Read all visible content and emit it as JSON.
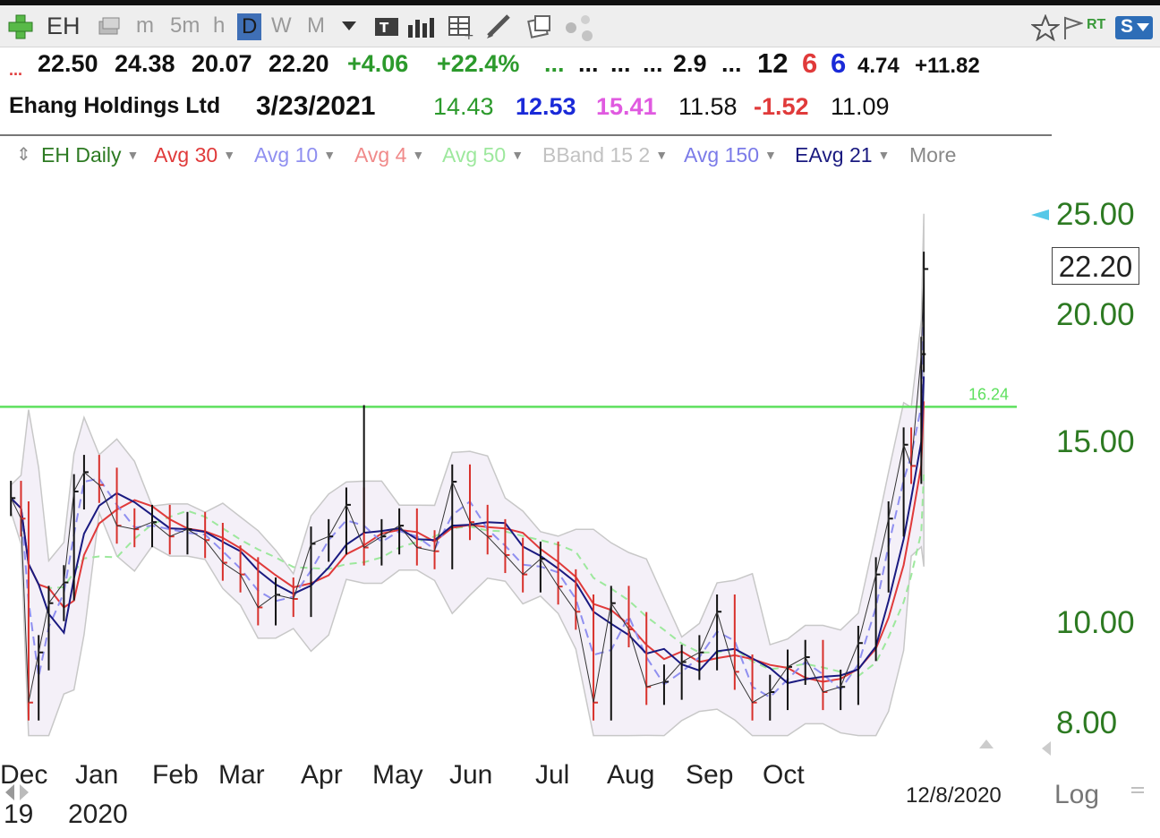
{
  "toolbar": {
    "symbol": "EH",
    "intervals": [
      "m",
      "5m",
      "h",
      "D",
      "W",
      "M"
    ],
    "selected_interval": "D",
    "rt_label": "RT",
    "s_label": "S"
  },
  "quote": {
    "open": "22.50",
    "high": "24.38",
    "low": "20.07",
    "close": "22.20",
    "change": "+4.06",
    "change_pct": "+22.4%",
    "dots1": "...",
    "dots2": "...",
    "dots3": "...",
    "dots4": "...",
    "v1": "2.9",
    "dots5": "...",
    "v2": "12",
    "v3": "6",
    "v4": "6",
    "v5": "4.74",
    "v6": "+11.82",
    "name": "Ehang Holdings Ltd",
    "date": "3/23/2021",
    "w1": "14.43",
    "w2": "12.53",
    "w3": "15.41",
    "w4": "11.58",
    "w5": "-1.52",
    "w6": "11.09"
  },
  "studies": [
    {
      "label": "EH Daily",
      "color": "#2d7a22"
    },
    {
      "label": "Avg 30",
      "color": "#e03a3a"
    },
    {
      "label": "Avg 10",
      "color": "#8f8ff0"
    },
    {
      "label": "Avg 4",
      "color": "#f08a8a"
    },
    {
      "label": "Avg 50",
      "color": "#9de89d"
    },
    {
      "label": "BBand 15 2",
      "color": "#c2c2c2"
    },
    {
      "label": "Avg 150",
      "color": "#7b7be8"
    },
    {
      "label": "EAvg 21",
      "color": "#1a1a80"
    },
    {
      "label": "More",
      "color": "#888888"
    }
  ],
  "chart_data": {
    "type": "line",
    "scale": "log",
    "ylim": [
      7.6,
      27
    ],
    "yticks": [
      "25.00",
      "20.00",
      "15.00",
      "10.00",
      "8.00"
    ],
    "last_price": "22.20",
    "horizontal_line": {
      "value": 16.24,
      "label": "16.24",
      "color": "#5ee05e"
    },
    "xticks": [
      "Dec",
      "Jan",
      "Feb",
      "Mar",
      "Apr",
      "May",
      "Jun",
      "Jul",
      "Aug",
      "Sep",
      "Oct"
    ],
    "year_labels": [
      "19",
      "2020"
    ],
    "cursor_date": "12/8/2020",
    "scale_label": "Log",
    "close_series": [
      [
        "2019-12-12",
        13.2
      ],
      [
        "2019-12-16",
        12.6
      ],
      [
        "2019-12-19",
        8.3
      ],
      [
        "2019-12-23",
        9.3
      ],
      [
        "2019-12-27",
        10.4
      ],
      [
        "2020-01-02",
        10.9
      ],
      [
        "2020-01-06",
        13.4
      ],
      [
        "2020-01-10",
        14.0
      ],
      [
        "2020-01-16",
        13.6
      ],
      [
        "2020-01-23",
        12.4
      ],
      [
        "2020-01-30",
        12.3
      ],
      [
        "2020-02-06",
        12.5
      ],
      [
        "2020-02-13",
        12.1
      ],
      [
        "2020-02-20",
        12.3
      ],
      [
        "2020-02-27",
        12.0
      ],
      [
        "2020-03-05",
        11.4
      ],
      [
        "2020-03-12",
        11.1
      ],
      [
        "2020-03-19",
        10.3
      ],
      [
        "2020-03-26",
        10.6
      ],
      [
        "2020-04-02",
        10.5
      ],
      [
        "2020-04-09",
        11.9
      ],
      [
        "2020-04-16",
        12.1
      ],
      [
        "2020-04-23",
        13.0
      ],
      [
        "2020-04-30",
        11.8
      ],
      [
        "2020-05-07",
        12.1
      ],
      [
        "2020-05-14",
        12.4
      ],
      [
        "2020-05-21",
        11.8
      ],
      [
        "2020-05-28",
        11.7
      ],
      [
        "2020-06-04",
        13.7
      ],
      [
        "2020-06-11",
        12.5
      ],
      [
        "2020-06-18",
        12.1
      ],
      [
        "2020-06-25",
        11.6
      ],
      [
        "2020-07-02",
        11.1
      ],
      [
        "2020-07-09",
        11.5
      ],
      [
        "2020-07-16",
        10.8
      ],
      [
        "2020-07-23",
        10.2
      ],
      [
        "2020-07-30",
        8.3
      ],
      [
        "2020-08-06",
        10.4
      ],
      [
        "2020-08-13",
        9.8
      ],
      [
        "2020-08-20",
        8.6
      ],
      [
        "2020-08-27",
        8.7
      ],
      [
        "2020-09-03",
        9.1
      ],
      [
        "2020-09-10",
        9.3
      ],
      [
        "2020-09-17",
        10.2
      ],
      [
        "2020-09-24",
        8.9
      ],
      [
        "2020-10-01",
        8.3
      ],
      [
        "2020-10-08",
        8.5
      ],
      [
        "2020-10-15",
        9.0
      ],
      [
        "2020-10-22",
        9.2
      ],
      [
        "2020-10-29",
        8.5
      ],
      [
        "2020-11-05",
        8.6
      ],
      [
        "2020-11-12",
        9.5
      ],
      [
        "2020-11-19",
        11.1
      ],
      [
        "2020-11-24",
        12.6
      ],
      [
        "2020-11-30",
        14.9
      ],
      [
        "2020-12-03",
        14.2
      ],
      [
        "2020-12-07",
        18.3
      ],
      [
        "2020-12-08",
        22.2
      ]
    ]
  }
}
